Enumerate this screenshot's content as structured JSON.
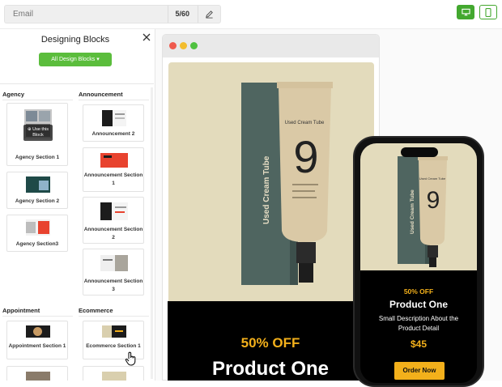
{
  "topbar": {
    "email_placeholder": "Email",
    "email_value": "",
    "char_count": "5/60"
  },
  "sidebar": {
    "title": "Designing Blocks",
    "filter_label": "All Design Blocks",
    "use_block_overlay": "Use this Block",
    "categories": {
      "agency": "Agency",
      "announcement": "Announcement",
      "appointment": "Appointment",
      "ecommerce": "Ecommerce"
    },
    "cards": {
      "agency_1": "Agency Section 1",
      "agency_2": "Agency Section 2",
      "agency_3": "Agency Section3",
      "announcement_2": "Announcement 2",
      "announcement_1": "Announcement Section 1",
      "announcement_s2": "Announcement Section 2",
      "announcement_s3": "Announcement Section 3",
      "appointment_1": "Appointment Section 1",
      "ecommerce_1": "Ecommerce Section 1"
    }
  },
  "preview": {
    "product_brand": "Used Cream Tube",
    "product_number": "9",
    "promo_off": "50% OFF",
    "product_title": "Product One"
  },
  "mobile": {
    "promo_off": "50% OFF",
    "product_title": "Product One",
    "description": "Small Description About the Product Detail",
    "price": "$45",
    "cta": "Order Now"
  },
  "colors": {
    "accent_green": "#43a82f",
    "promo_yellow": "#f3b01b",
    "hero_beige": "#e3dbbc",
    "box_teal": "#4f6560"
  }
}
